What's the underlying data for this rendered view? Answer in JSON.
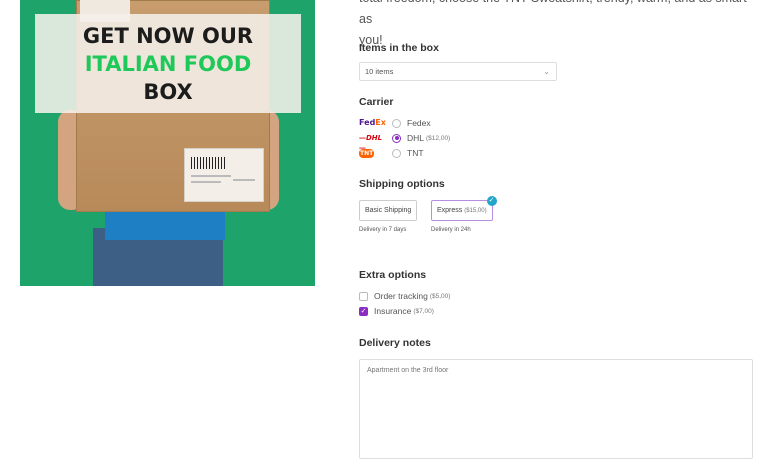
{
  "intro": {
    "text_line1": "total freedom, choose the TNT Sweatshirt, trendy, warm, and as smart as",
    "text_line2": "you!"
  },
  "product": {
    "banner_line1": "GET NOW OUR",
    "banner_line2": "ITALIAN FOOD",
    "banner_line3": "BOX",
    "banner_colors": {
      "dark": "#1c1c1c",
      "green": "#1ec95a"
    },
    "background_color": "#1ea46b"
  },
  "items_in_box": {
    "title": "Items in the box",
    "selected": "10 items",
    "chevron_icon": "chevron-down-icon"
  },
  "carrier": {
    "title": "Carrier",
    "options": [
      {
        "logo": "FedEx",
        "label": "Fedex",
        "price": "",
        "checked": false
      },
      {
        "logo": "DHL",
        "label": "DHL",
        "price": "($12,00)",
        "checked": true
      },
      {
        "logo": "TNT",
        "label": "TNT",
        "price": "",
        "checked": false
      }
    ]
  },
  "shipping": {
    "title": "Shipping options",
    "options": [
      {
        "label": "Basic Shipping",
        "sub": "Delivery in 7 days",
        "selected": false
      },
      {
        "label": "Express",
        "price": "($15,00)",
        "sub": "Delivery in 24h",
        "selected": true
      }
    ]
  },
  "extras": {
    "title": "Extra options",
    "options": [
      {
        "label": "Order tracking",
        "price": "($5,00)",
        "checked": false
      },
      {
        "label": "Insurance",
        "price": "($7,00)",
        "checked": true
      }
    ]
  },
  "notes": {
    "title": "Delivery notes",
    "placeholder": "Apartment on the 3rd floor"
  },
  "colors": {
    "accent": "#8a2ec2",
    "check_badge": "#23a6c9"
  }
}
